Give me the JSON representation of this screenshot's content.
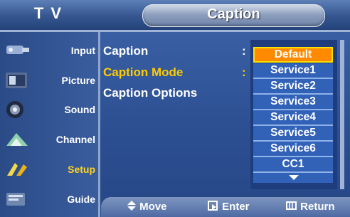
{
  "header": {
    "section": "T V",
    "title": "Caption"
  },
  "sidebar": {
    "items": [
      {
        "label": "Input",
        "icon": "input-icon"
      },
      {
        "label": "Picture",
        "icon": "picture-icon"
      },
      {
        "label": "Sound",
        "icon": "sound-icon"
      },
      {
        "label": "Channel",
        "icon": "channel-icon"
      },
      {
        "label": "Setup",
        "icon": "setup-icon",
        "active": true
      },
      {
        "label": "Guide",
        "icon": "guide-icon"
      }
    ]
  },
  "menu": {
    "items": [
      {
        "label": "Caption",
        "colon": ":"
      },
      {
        "label": "Caption Mode",
        "colon": ":",
        "active": true
      },
      {
        "label": "Caption Options"
      }
    ]
  },
  "dropdown": {
    "options": [
      "Default",
      "Service1",
      "Service2",
      "Service3",
      "Service4",
      "Service5",
      "Service6",
      "CC1"
    ],
    "selected": "Default"
  },
  "footer": {
    "move": "Move",
    "enter": "Enter",
    "return": "Return"
  },
  "colors": {
    "accent": "#ffcc00",
    "highlight": "#ff8a00",
    "background": "#2f4f8f"
  }
}
